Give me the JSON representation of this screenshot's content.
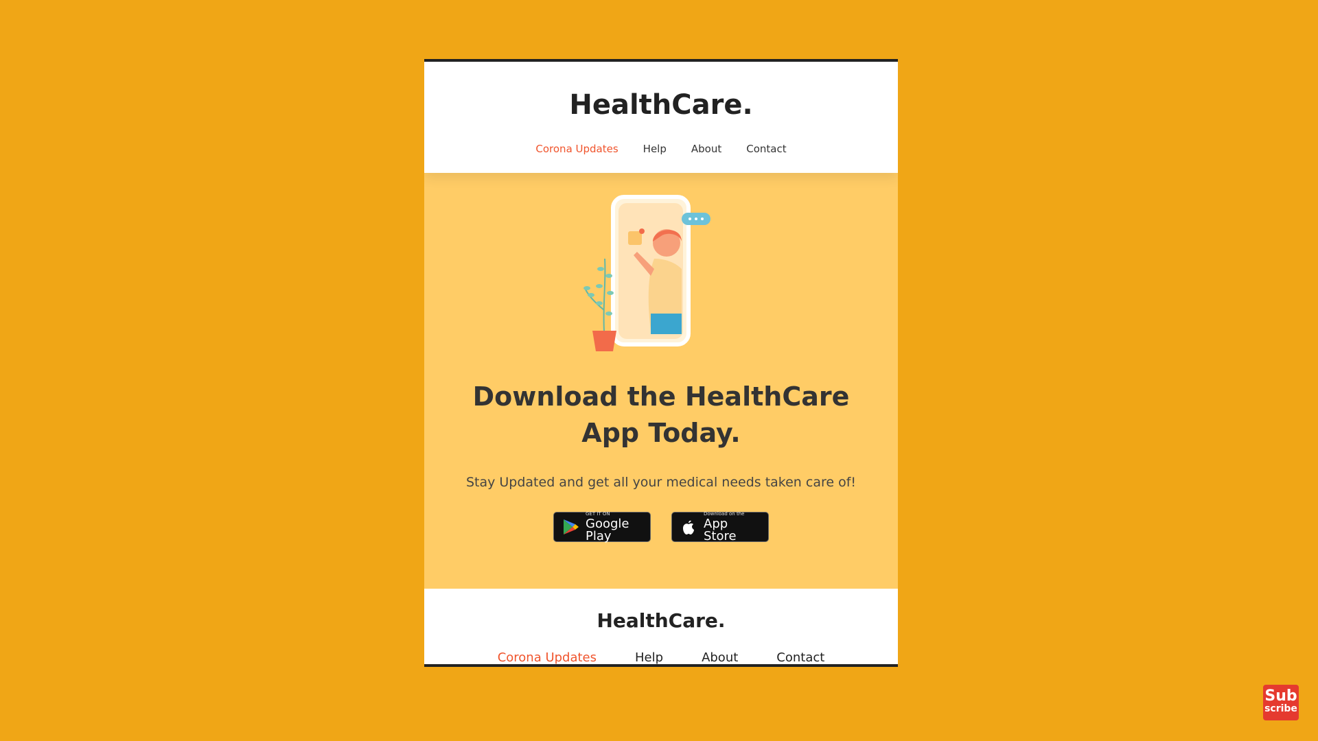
{
  "header": {
    "brand": "HealthCare.",
    "nav": [
      {
        "label": "Corona Updates",
        "active": true
      },
      {
        "label": "Help",
        "active": false
      },
      {
        "label": "About",
        "active": false
      },
      {
        "label": "Contact",
        "active": false
      }
    ]
  },
  "hero": {
    "headline": "Download the HealthCare App Today.",
    "subtext": "Stay Updated and get all your medical needs taken care of!",
    "buttons": {
      "google_small": "GET IT ON",
      "google_big": "Google Play",
      "apple_small": "Download on the",
      "apple_big": "App Store"
    }
  },
  "footer": {
    "brand": "HealthCare.",
    "nav": [
      {
        "label": "Corona Updates",
        "active": true
      },
      {
        "label": "Help",
        "active": false
      },
      {
        "label": "About",
        "active": false
      },
      {
        "label": "Contact",
        "active": false
      }
    ]
  },
  "subscribe_badge": {
    "line1": "Sub",
    "line2": "scribe"
  },
  "colors": {
    "background": "#F0A616",
    "hero": "#FFCC66",
    "accent": "#F0542C",
    "subscribe": "#E53A2F"
  },
  "icons": {
    "google_play": "google-play-icon",
    "apple": "apple-icon"
  }
}
